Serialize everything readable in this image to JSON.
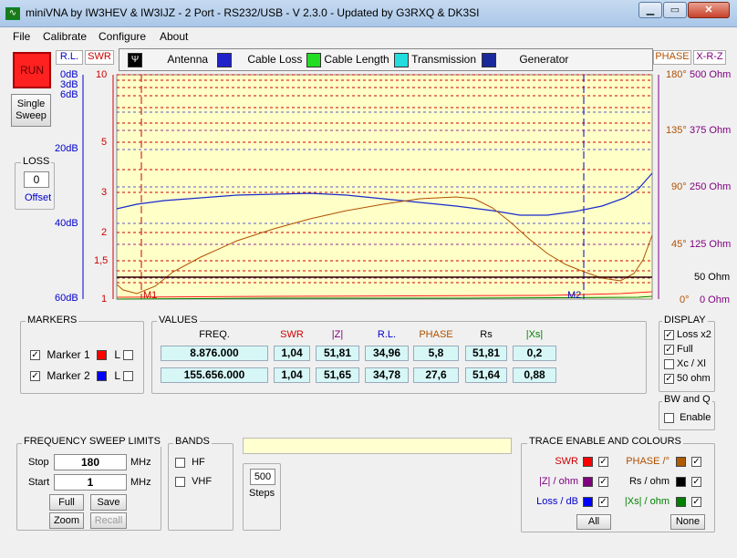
{
  "window": {
    "title": "miniVNA by IW3HEV & IW3IJZ - 2 Port - RS232/USB - V 2.3.0 - Updated by G3RXQ & DK3SI"
  },
  "menu": [
    "File",
    "Calibrate",
    "Configure",
    "About"
  ],
  "left": {
    "run": "RUN",
    "single_sweep_1": "Single",
    "single_sweep_2": "Sweep",
    "loss_label": "LOSS",
    "loss_value": "0",
    "offset": "Offset"
  },
  "axis_tabs": {
    "rl": "R.L.",
    "swr": "SWR",
    "phase": "PHASE",
    "xrz": "X-R-Z"
  },
  "tabs": [
    "Antenna",
    "Cable Loss",
    "Cable Length",
    "Transmission",
    "Generator"
  ],
  "left_axes": {
    "rl_ticks": [
      "0dB",
      "3dB",
      "6dB",
      "20dB",
      "40dB",
      "60dB"
    ],
    "swr_ticks": [
      "10",
      "5",
      "3",
      "2",
      "1,5",
      "1"
    ]
  },
  "right_axes": {
    "phase_ticks": [
      "180°",
      "135°",
      "90°",
      "45°",
      "0°"
    ],
    "ohm_ticks": [
      "500 Ohm",
      "375 Ohm",
      "250 Ohm",
      "125 Ohm",
      "50 Ohm",
      "0 Ohm"
    ]
  },
  "markers_plot": {
    "m1": "M1",
    "m2": "M2"
  },
  "markers_panel": {
    "title": "MARKERS",
    "items": [
      {
        "label": "Marker 1",
        "color": "#ff0000",
        "l": "L"
      },
      {
        "label": "Marker 2",
        "color": "#0000ff",
        "l": "L"
      }
    ]
  },
  "values": {
    "title": "VALUES",
    "headers": [
      "FREQ.",
      "SWR",
      "|Z|",
      "R.L.",
      "PHASE",
      "Rs",
      "|Xs|"
    ],
    "header_colors": [
      "#000000",
      "#cc0000",
      "#800080",
      "#0000cc",
      "#b05000",
      "#000000",
      "#008000"
    ],
    "rows": [
      [
        "8.876.000",
        "1,04",
        "51,81",
        "34,96",
        "5,8",
        "51,81",
        "0,2"
      ],
      [
        "155.656.000",
        "1,04",
        "51,65",
        "34,78",
        "27,6",
        "51,64",
        "0,88"
      ]
    ]
  },
  "display": {
    "title": "DISPLAY",
    "items": [
      {
        "label": "Loss x2",
        "checked": true
      },
      {
        "label": "Full",
        "checked": true
      },
      {
        "label": "Xc / Xl",
        "checked": false
      },
      {
        "label": "50 ohm",
        "checked": true
      }
    ]
  },
  "bwq": {
    "title": "BW and Q",
    "enable": "Enable"
  },
  "sweep": {
    "title": "FREQUENCY SWEEP LIMITS",
    "stop_label": "Stop",
    "stop_value": "180",
    "start_label": "Start",
    "start_value": "1",
    "unit": "MHz",
    "full": "Full",
    "save": "Save",
    "zoom": "Zoom",
    "recall": "Recall"
  },
  "bands": {
    "title": "BANDS",
    "hf": "HF",
    "vhf": "VHF"
  },
  "steps": {
    "value": "500",
    "label": "Steps"
  },
  "traces": {
    "title": "TRACE ENABLE AND COLOURS",
    "left": [
      {
        "label": "SWR",
        "label_color": "#cc0000",
        "swatch": "#ff0000"
      },
      {
        "label": "|Z| / ohm",
        "label_color": "#800080",
        "swatch": "#800080"
      },
      {
        "label": "Loss / dB",
        "label_color": "#0000cc",
        "swatch": "#0000ff"
      }
    ],
    "right": [
      {
        "label": "PHASE /°",
        "label_color": "#b05000",
        "swatch": "#b05a00"
      },
      {
        "label": "Rs / ohm",
        "label_color": "#000000",
        "swatch": "#000000"
      },
      {
        "label": "|Xs| / ohm",
        "label_color": "#008000",
        "swatch": "#008000"
      }
    ],
    "all": "All",
    "none": "None"
  }
}
